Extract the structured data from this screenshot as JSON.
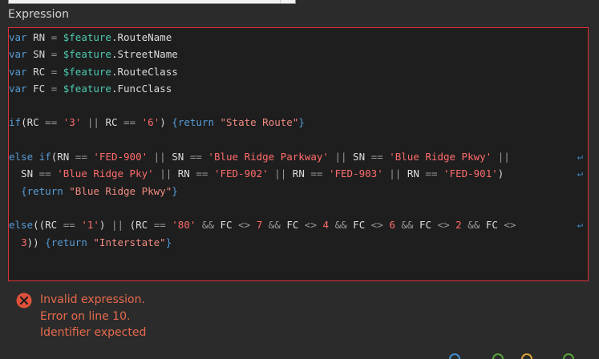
{
  "section_label": "Expression",
  "editor": {
    "border_color": "#e0303a",
    "lines": [
      {
        "wrapped": false,
        "tokens": [
          {
            "t": "var",
            "c": "kw"
          },
          {
            "t": " RN ",
            "c": "var"
          },
          {
            "t": "=",
            "c": "op"
          },
          {
            "t": " ",
            "c": "plain"
          },
          {
            "t": "$feature",
            "c": "feat"
          },
          {
            "t": ".RouteName",
            "c": "plain"
          }
        ]
      },
      {
        "wrapped": false,
        "tokens": [
          {
            "t": "var",
            "c": "kw"
          },
          {
            "t": " SN ",
            "c": "var"
          },
          {
            "t": "=",
            "c": "op"
          },
          {
            "t": " ",
            "c": "plain"
          },
          {
            "t": "$feature",
            "c": "feat"
          },
          {
            "t": ".StreetName",
            "c": "plain"
          }
        ]
      },
      {
        "wrapped": false,
        "tokens": [
          {
            "t": "var",
            "c": "kw"
          },
          {
            "t": " RC ",
            "c": "var"
          },
          {
            "t": "=",
            "c": "op"
          },
          {
            "t": " ",
            "c": "plain"
          },
          {
            "t": "$feature",
            "c": "feat"
          },
          {
            "t": ".RouteClass",
            "c": "plain"
          }
        ]
      },
      {
        "wrapped": false,
        "tokens": [
          {
            "t": "var",
            "c": "kw"
          },
          {
            "t": " FC ",
            "c": "var"
          },
          {
            "t": "=",
            "c": "op"
          },
          {
            "t": " ",
            "c": "plain"
          },
          {
            "t": "$feature",
            "c": "feat"
          },
          {
            "t": ".FuncClass",
            "c": "plain"
          }
        ]
      },
      {
        "wrapped": false,
        "tokens": []
      },
      {
        "wrapped": false,
        "tokens": [
          {
            "t": "if",
            "c": "kw"
          },
          {
            "t": "(RC ",
            "c": "plain"
          },
          {
            "t": "==",
            "c": "op"
          },
          {
            "t": " ",
            "c": "plain"
          },
          {
            "t": "'3'",
            "c": "str"
          },
          {
            "t": " ",
            "c": "plain"
          },
          {
            "t": "||",
            "c": "op"
          },
          {
            "t": " RC ",
            "c": "plain"
          },
          {
            "t": "==",
            "c": "op"
          },
          {
            "t": " ",
            "c": "plain"
          },
          {
            "t": "'6'",
            "c": "str"
          },
          {
            "t": ") ",
            "c": "plain"
          },
          {
            "t": "{",
            "c": "kw"
          },
          {
            "t": "return",
            "c": "kw"
          },
          {
            "t": " ",
            "c": "plain"
          },
          {
            "t": "\"State Route\"",
            "c": "dstr"
          },
          {
            "t": "}",
            "c": "kw"
          }
        ]
      },
      {
        "wrapped": false,
        "tokens": []
      },
      {
        "wrapped": true,
        "tokens": [
          {
            "t": "else if",
            "c": "kw"
          },
          {
            "t": "(RN ",
            "c": "plain"
          },
          {
            "t": "==",
            "c": "op"
          },
          {
            "t": " ",
            "c": "plain"
          },
          {
            "t": "'FED-900'",
            "c": "str"
          },
          {
            "t": " ",
            "c": "plain"
          },
          {
            "t": "||",
            "c": "op"
          },
          {
            "t": " SN ",
            "c": "plain"
          },
          {
            "t": "==",
            "c": "op"
          },
          {
            "t": " ",
            "c": "plain"
          },
          {
            "t": "'Blue Ridge Parkway'",
            "c": "str"
          },
          {
            "t": " ",
            "c": "plain"
          },
          {
            "t": "||",
            "c": "op"
          },
          {
            "t": " SN ",
            "c": "plain"
          },
          {
            "t": "==",
            "c": "op"
          },
          {
            "t": " ",
            "c": "plain"
          },
          {
            "t": "'Blue Ridge Pkwy'",
            "c": "str"
          },
          {
            "t": " ",
            "c": "plain"
          },
          {
            "t": "||",
            "c": "op"
          }
        ]
      },
      {
        "wrapped": true,
        "tokens": [
          {
            "t": "  SN ",
            "c": "plain"
          },
          {
            "t": "==",
            "c": "op"
          },
          {
            "t": " ",
            "c": "plain"
          },
          {
            "t": "'Blue Ridge Pky'",
            "c": "str"
          },
          {
            "t": " ",
            "c": "plain"
          },
          {
            "t": "||",
            "c": "op"
          },
          {
            "t": " RN ",
            "c": "plain"
          },
          {
            "t": "==",
            "c": "op"
          },
          {
            "t": " ",
            "c": "plain"
          },
          {
            "t": "'FED-902'",
            "c": "str"
          },
          {
            "t": " ",
            "c": "plain"
          },
          {
            "t": "||",
            "c": "op"
          },
          {
            "t": " RN ",
            "c": "plain"
          },
          {
            "t": "==",
            "c": "op"
          },
          {
            "t": " ",
            "c": "plain"
          },
          {
            "t": "'FED-903'",
            "c": "str"
          },
          {
            "t": " ",
            "c": "plain"
          },
          {
            "t": "||",
            "c": "op"
          },
          {
            "t": " RN ",
            "c": "plain"
          },
          {
            "t": "==",
            "c": "op"
          },
          {
            "t": " ",
            "c": "plain"
          },
          {
            "t": "'FED-901'",
            "c": "str"
          },
          {
            "t": ")",
            "c": "plain"
          }
        ]
      },
      {
        "wrapped": false,
        "tokens": [
          {
            "t": "  ",
            "c": "plain"
          },
          {
            "t": "{",
            "c": "kw"
          },
          {
            "t": "return",
            "c": "kw"
          },
          {
            "t": " ",
            "c": "plain"
          },
          {
            "t": "\"Blue Ridge Pkwy\"",
            "c": "dstr"
          },
          {
            "t": "}",
            "c": "kw"
          }
        ]
      },
      {
        "wrapped": false,
        "tokens": []
      },
      {
        "wrapped": true,
        "tokens": [
          {
            "t": "else",
            "c": "kw"
          },
          {
            "t": "((RC ",
            "c": "plain"
          },
          {
            "t": "==",
            "c": "op"
          },
          {
            "t": " ",
            "c": "plain"
          },
          {
            "t": "'1'",
            "c": "str"
          },
          {
            "t": ") ",
            "c": "plain"
          },
          {
            "t": "||",
            "c": "op"
          },
          {
            "t": " (RC ",
            "c": "plain"
          },
          {
            "t": "==",
            "c": "op"
          },
          {
            "t": " ",
            "c": "plain"
          },
          {
            "t": "'80'",
            "c": "str"
          },
          {
            "t": " ",
            "c": "plain"
          },
          {
            "t": "&&",
            "c": "op"
          },
          {
            "t": " FC ",
            "c": "plain"
          },
          {
            "t": "<>",
            "c": "op"
          },
          {
            "t": " ",
            "c": "plain"
          },
          {
            "t": "7",
            "c": "num"
          },
          {
            "t": " ",
            "c": "plain"
          },
          {
            "t": "&&",
            "c": "op"
          },
          {
            "t": " FC ",
            "c": "plain"
          },
          {
            "t": "<>",
            "c": "op"
          },
          {
            "t": " ",
            "c": "plain"
          },
          {
            "t": "4",
            "c": "num"
          },
          {
            "t": " ",
            "c": "plain"
          },
          {
            "t": "&&",
            "c": "op"
          },
          {
            "t": " FC ",
            "c": "plain"
          },
          {
            "t": "<>",
            "c": "op"
          },
          {
            "t": " ",
            "c": "plain"
          },
          {
            "t": "6",
            "c": "num"
          },
          {
            "t": " ",
            "c": "plain"
          },
          {
            "t": "&&",
            "c": "op"
          },
          {
            "t": " FC ",
            "c": "plain"
          },
          {
            "t": "<>",
            "c": "op"
          },
          {
            "t": " ",
            "c": "plain"
          },
          {
            "t": "2",
            "c": "num"
          },
          {
            "t": " ",
            "c": "plain"
          },
          {
            "t": "&&",
            "c": "op"
          },
          {
            "t": " FC ",
            "c": "plain"
          },
          {
            "t": "<>",
            "c": "op"
          }
        ]
      },
      {
        "wrapped": false,
        "tokens": [
          {
            "t": "  ",
            "c": "plain"
          },
          {
            "t": "3",
            "c": "num"
          },
          {
            "t": ")) ",
            "c": "plain"
          },
          {
            "t": "{",
            "c": "kw"
          },
          {
            "t": "return",
            "c": "kw"
          },
          {
            "t": " ",
            "c": "plain"
          },
          {
            "t": "\"Interstate\"",
            "c": "dstr"
          },
          {
            "t": "}",
            "c": "kw"
          }
        ]
      }
    ]
  },
  "error": {
    "icon": "error-circle-icon",
    "lines": [
      "Invalid expression.",
      "Error on line 10.",
      "Identifier expected"
    ]
  },
  "bottom_icons": [
    {
      "name": "help-icon",
      "color": "#3f8fd6"
    },
    {
      "name": "arrow-icon",
      "color": "#5aa33a"
    },
    {
      "name": "folder-icon",
      "color": "#d9a23a"
    },
    {
      "name": "check-icon",
      "color": "#5aa33a"
    }
  ]
}
